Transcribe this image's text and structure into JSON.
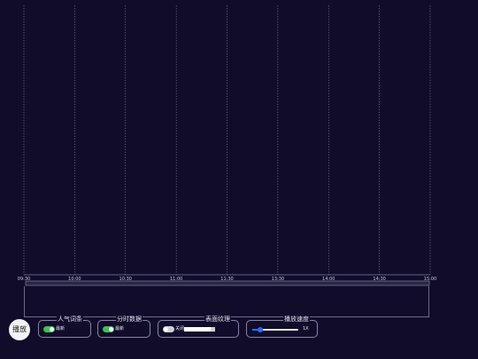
{
  "chart_data": {
    "type": "line",
    "x_ticks": [
      "09:30",
      "10:00",
      "10:30",
      "11:00",
      "11:30",
      "13:30",
      "14:00",
      "14:30",
      "15:00"
    ],
    "series": [],
    "grid": true
  },
  "controls": {
    "play_label": "播放",
    "popularity_panel": {
      "title": "人气词条",
      "switch_on": true,
      "switch_label": "最新"
    },
    "intraday_panel": {
      "title": "分时数据",
      "switch_on": true,
      "switch_label": "最新"
    },
    "surface_panel": {
      "title": "表面纹理",
      "switch_on": false,
      "switch_label": "关闭",
      "field_value": ""
    },
    "speed_panel": {
      "title": "播放速度",
      "value_label": "1X",
      "level": 0.17
    }
  },
  "colors": {
    "background": "#100c2a",
    "gridline": "#8f8bb0",
    "accent": "#2f6bff",
    "switch_on": "#3fbf55"
  }
}
